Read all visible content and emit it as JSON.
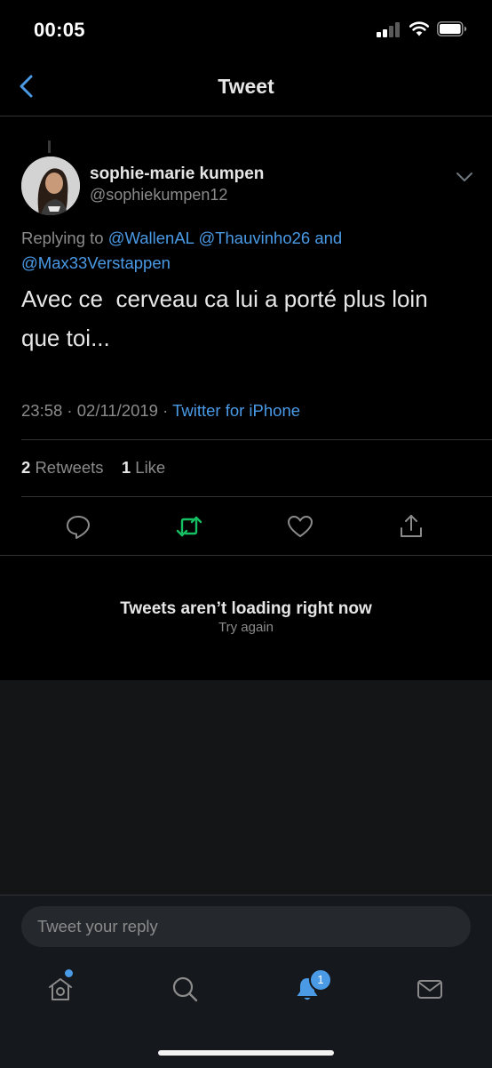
{
  "status_bar": {
    "time": "00:05"
  },
  "header": {
    "title": "Tweet"
  },
  "tweet": {
    "display_name": "sophie-marie kumpen",
    "handle": "@sophiekumpen12",
    "replying_prefix": "Replying to",
    "reply_mentions": [
      "@WallenAL",
      "@Thauvinho26"
    ],
    "reply_and": "and",
    "reply_last_mention": "@Max33Verstappen",
    "text_line1": "Avec ce  cerveau ca lui a porté plus loin",
    "text_line2": "que toi...",
    "timestamp": "23:58 · 02/11/2019 ·",
    "source": "Twitter for iPhone",
    "retweets_count": "2",
    "retweets_label": "Retweets",
    "likes_count": "1",
    "likes_label": "Like"
  },
  "error": {
    "title": "Tweets aren’t loading right now",
    "retry": "Try again"
  },
  "composer": {
    "placeholder": "Tweet your reply"
  },
  "tab_bar": {
    "notifications_badge": "1",
    "tabs": [
      "home-icon",
      "search-icon",
      "notifications-icon",
      "messages-icon"
    ]
  },
  "colors": {
    "accent": "#4a9ae6",
    "retweet_green": "#17bf63",
    "background": "#000000",
    "composer_background": "#15181c"
  }
}
